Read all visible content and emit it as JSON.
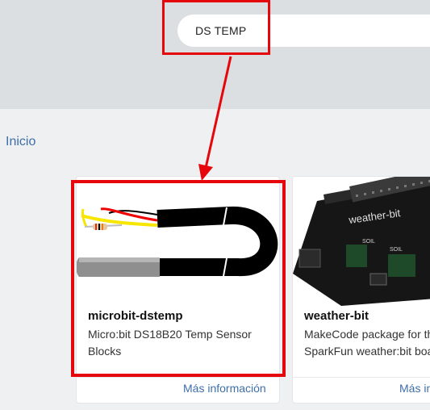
{
  "search": {
    "query": "DS TEMP"
  },
  "breadcrumb": {
    "label": "Inicio"
  },
  "cards": [
    {
      "title": "microbit-dstemp",
      "description_line1": "Micro:bit DS18B20 Temp Sensor",
      "description_line2": "Blocks",
      "link": "Más información"
    },
    {
      "title": "weather-bit",
      "description_line1": "MakeCode package for th",
      "description_line2": "SparkFun weather:bit boa",
      "link": "Más in",
      "image_label": "weather-bit"
    }
  ],
  "colors": {
    "annotation_red": "#e6070c",
    "link_blue": "#3f6ea8",
    "header_gray": "#dcdfe2",
    "page_gray": "#eef0f2"
  },
  "icons": [
    "temperature-probe-image",
    "weather-bit-board-image",
    "annotation-arrow"
  ]
}
